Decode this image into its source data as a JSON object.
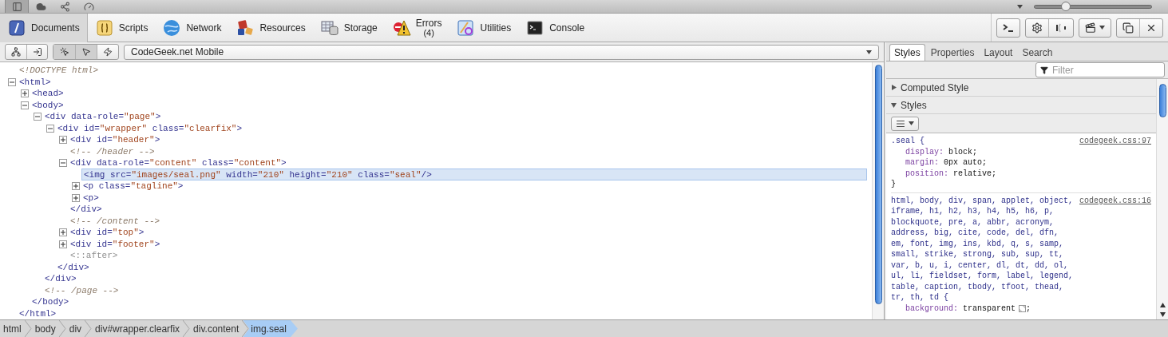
{
  "top_bar": {
    "buttons": [
      {
        "kind": "dock",
        "selected": true
      },
      {
        "kind": "cloud",
        "selected": false
      },
      {
        "kind": "share",
        "selected": false
      },
      {
        "kind": "gauge",
        "selected": false
      }
    ],
    "zoom_slider": {
      "level": 0.27
    }
  },
  "toolbar": {
    "tabs": [
      {
        "kind": "documents",
        "label": "Documents",
        "selected": true
      },
      {
        "kind": "scripts",
        "label": "Scripts",
        "selected": false
      },
      {
        "kind": "network",
        "label": "Network",
        "selected": false
      },
      {
        "kind": "resources",
        "label": "Resources",
        "selected": false
      },
      {
        "kind": "storage",
        "label": "Storage",
        "selected": false
      },
      {
        "kind": "errors",
        "label": "Errors",
        "count": "(4)",
        "selected": false
      },
      {
        "kind": "utilities",
        "label": "Utilities",
        "selected": false
      },
      {
        "kind": "console",
        "label": "Console",
        "selected": false
      }
    ],
    "button_groups": [
      [
        {
          "kind": "prompt"
        }
      ],
      [
        {
          "kind": "settings"
        },
        {
          "kind": "toggle"
        }
      ],
      [
        {
          "kind": "film",
          "menu": true
        }
      ],
      [
        {
          "kind": "detach"
        },
        {
          "kind": "close"
        }
      ]
    ]
  },
  "nav_bar": {
    "buttons": [
      {
        "kind": "tree"
      },
      {
        "kind": "export"
      }
    ],
    "modes": [
      {
        "kind": "inspect",
        "selected": true
      },
      {
        "kind": "pointer",
        "selected": true
      },
      {
        "kind": "events",
        "selected": false
      }
    ],
    "page_select": {
      "value": "CodeGeek.net Mobile"
    }
  },
  "dom_tree": [
    {
      "kind": "comment",
      "text": "<!DOCTYPE html>",
      "selected": false
    },
    {
      "kind": "element",
      "text": "<html>",
      "expanded": true,
      "selected": false,
      "closing": "</html>",
      "children": [
        {
          "kind": "element",
          "text": "<head>",
          "expanded": false,
          "selected": false
        },
        {
          "kind": "element",
          "text": "<body>",
          "expanded": true,
          "selected": false,
          "closing": "</body>",
          "children": [
            {
              "kind": "element",
              "text": "<div data-role=\"page\">",
              "expanded": true,
              "selected": false,
              "closing": "</div>",
              "children": [
                {
                  "kind": "element",
                  "text": "<div id=\"wrapper\" class=\"clearfix\">",
                  "expanded": true,
                  "selected": false,
                  "closing": "</div>",
                  "children": [
                    {
                      "kind": "element",
                      "text": "<div id=\"header\">",
                      "expanded": false,
                      "selected": false
                    },
                    {
                      "kind": "comment",
                      "text": "<!-- /header -->",
                      "selected": false
                    },
                    {
                      "kind": "element",
                      "text": "<div data-role=\"content\" class=\"content\">",
                      "expanded": true,
                      "selected": false,
                      "closing": "</div>",
                      "children": [
                        {
                          "kind": "element",
                          "text": "<img src=\"images/seal.png\" width=\"210\" height=\"210\" class=\"seal\"/>",
                          "selected": true
                        },
                        {
                          "kind": "element",
                          "text": "<p class=\"tagline\">",
                          "expanded": false,
                          "selected": false
                        },
                        {
                          "kind": "element",
                          "text": "<p>",
                          "expanded": false,
                          "selected": false
                        }
                      ]
                    },
                    {
                      "kind": "comment",
                      "text": "<!-- /content -->",
                      "selected": false
                    },
                    {
                      "kind": "element",
                      "text": "<div id=\"top\">",
                      "expanded": false,
                      "selected": false
                    },
                    {
                      "kind": "element",
                      "text": "<div id=\"footer\">",
                      "expanded": false,
                      "selected": false
                    },
                    {
                      "kind": "pseudo",
                      "text": "<::after>",
                      "selected": false
                    }
                  ]
                }
              ]
            },
            {
              "kind": "comment",
              "text": "<!-- /page -->",
              "selected": false
            }
          ]
        }
      ]
    }
  ],
  "breadcrumbs": [
    {
      "label": "html",
      "selected": false
    },
    {
      "label": "body",
      "selected": false
    },
    {
      "label": "div",
      "selected": false
    },
    {
      "label": "div#wrapper.clearfix",
      "selected": false
    },
    {
      "label": "div.content",
      "selected": false
    },
    {
      "label": "img.seal",
      "selected": true
    }
  ],
  "sidebar": {
    "tabs": [
      {
        "label": "Styles",
        "selected": true
      },
      {
        "label": "Properties",
        "selected": false
      },
      {
        "label": "Layout",
        "selected": false
      },
      {
        "label": "Search",
        "selected": false
      }
    ],
    "filter": {
      "placeholder": "Filter"
    },
    "sections": [
      {
        "label": "Computed Style",
        "expanded": false
      },
      {
        "label": "Styles",
        "expanded": true
      }
    ],
    "rules": [
      {
        "selector": ".seal {",
        "source": "codegeek.css:97",
        "declarations": [
          {
            "property": "display:",
            "value": "block;"
          },
          {
            "property": "margin:",
            "value": "0px auto;"
          },
          {
            "property": "position:",
            "value": "relative;"
          }
        ],
        "close": "}"
      },
      {
        "selector": "html, body, div, span, applet, object, iframe, h1, h2, h3, h4, h5, h6, p, blockquote, pre, a, abbr, acronym, address, big, cite, code, del, dfn, em, font, img, ins, kbd, q, s, samp, small, strike, strong, sub, sup, tt, var, b, u, i, center, dl, dt, dd, ol, ul, li, fieldset, form, label, legend, table, caption, tbody, tfoot, thead, tr, th, td {",
        "source": "codegeek.css:16",
        "declarations": [
          {
            "property": "background:",
            "value": "transparent",
            "swatch": true,
            "end": ";"
          }
        ]
      }
    ]
  }
}
